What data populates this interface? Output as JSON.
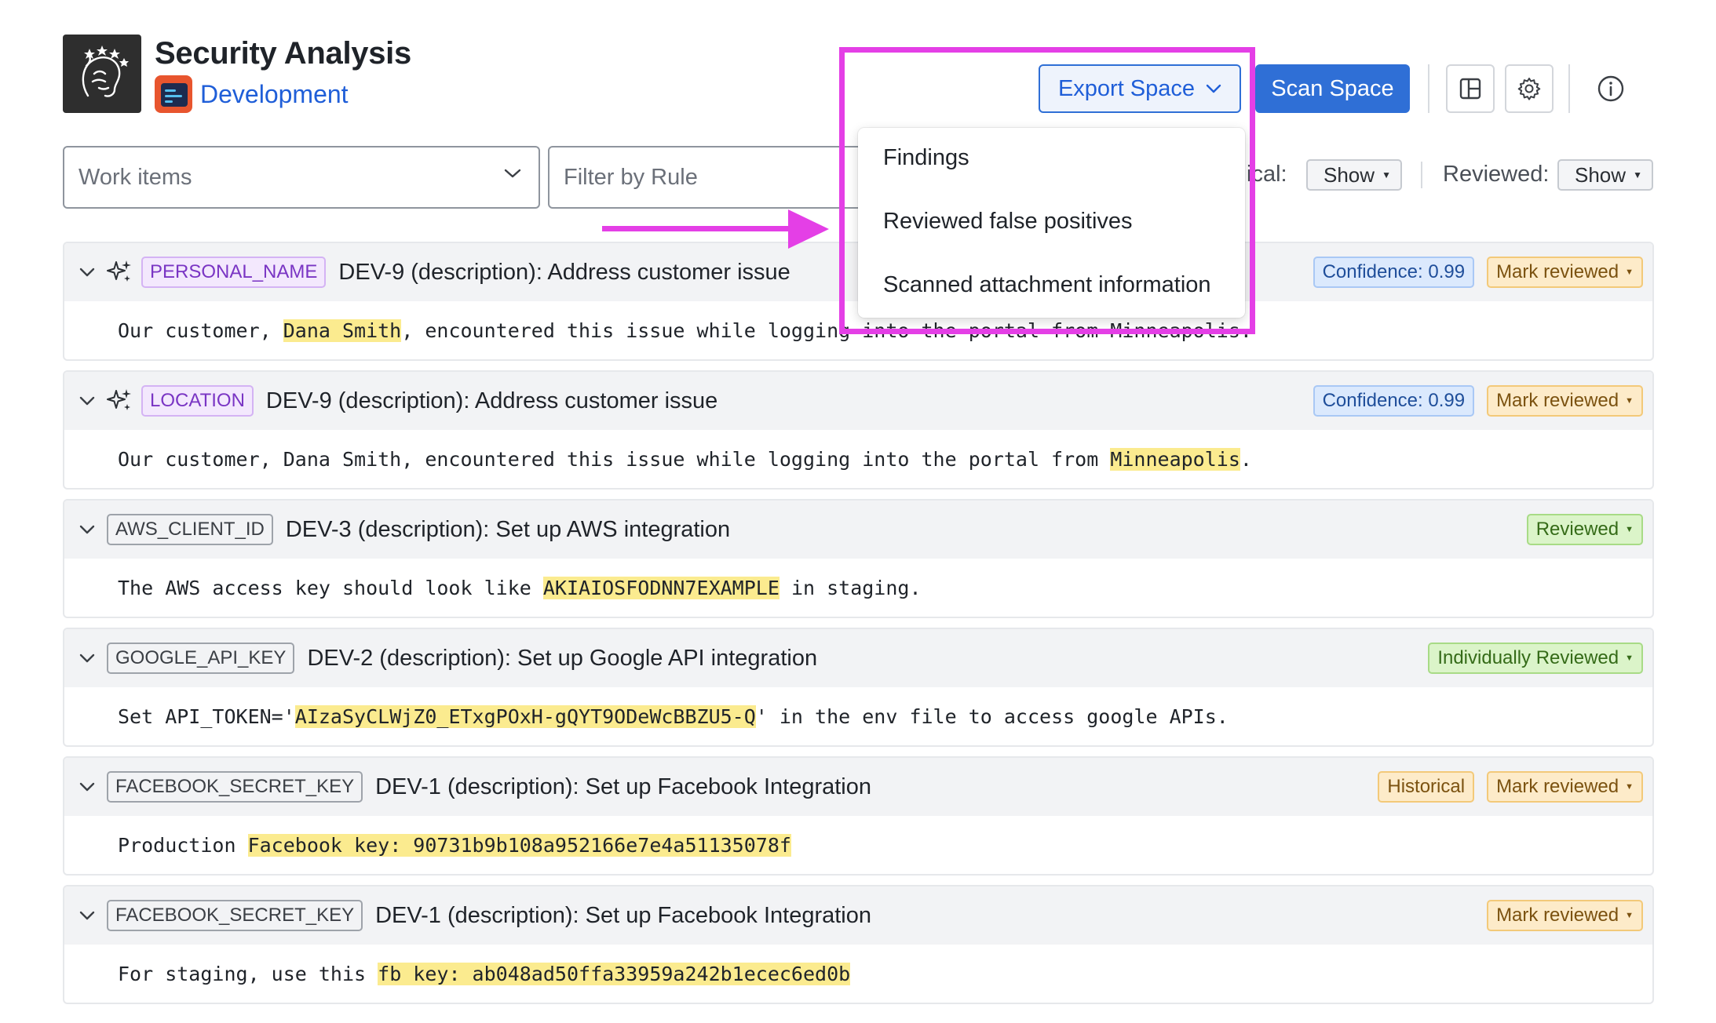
{
  "header": {
    "title": "Security Analysis",
    "space_name": "Development",
    "export_label": "Export Space",
    "scan_label": "Scan Space"
  },
  "filters": {
    "work_items_placeholder": "Work items",
    "rule_placeholder": "Filter by Rule",
    "historical_label_partial": "ical:",
    "historical_value": "Show",
    "reviewed_label": "Reviewed:",
    "reviewed_value": "Show"
  },
  "export_menu": {
    "items": [
      "Findings",
      "Reviewed false positives",
      "Scanned attachment information"
    ]
  },
  "findings": [
    {
      "rule": "PERSONAL_NAME",
      "title": "DEV-9 (description): Address customer issue",
      "ai_detected": true,
      "badges": [
        "Confidence: 0.99",
        "Mark reviewed"
      ],
      "text_before": "Our customer, ",
      "match": "Dana Smith",
      "text_after": ", encountered this issue while logging into the portal from Minneapolis."
    },
    {
      "rule": "LOCATION",
      "title": "DEV-9 (description): Address customer issue",
      "ai_detected": true,
      "badges": [
        "Confidence: 0.99",
        "Mark reviewed"
      ],
      "text_before": "Our customer, Dana Smith, encountered this issue while logging into the portal from ",
      "match": "Minneapolis",
      "text_after": "."
    },
    {
      "rule": "AWS_CLIENT_ID",
      "title": "DEV-3 (description): Set up AWS integration",
      "ai_detected": false,
      "badges": [
        "Reviewed"
      ],
      "text_before": "The AWS access key should look like ",
      "match": "AKIAIOSFODNN7EXAMPLE",
      "text_after": " in staging."
    },
    {
      "rule": "GOOGLE_API_KEY",
      "title": "DEV-2 (description): Set up Google API integration",
      "ai_detected": false,
      "badges": [
        "Individually Reviewed"
      ],
      "text_before": "Set API_TOKEN='",
      "match": "AIzaSyCLWjZ0_ETxgPOxH-gQYT9ODeWcBBZU5-Q",
      "text_after": "' in the env file to access google APIs."
    },
    {
      "rule": "FACEBOOK_SECRET_KEY",
      "title": "DEV-1 (description): Set up Facebook Integration",
      "ai_detected": false,
      "badges": [
        "Historical",
        "Mark reviewed"
      ],
      "text_before": "Production ",
      "match": "Facebook key: 90731b9b108a952166e7e4a51135078f",
      "text_after": ""
    },
    {
      "rule": "FACEBOOK_SECRET_KEY",
      "title": "DEV-1 (description): Set up Facebook Integration",
      "ai_detected": false,
      "badges": [
        "Mark reviewed"
      ],
      "text_before": "For staging, use this ",
      "match": "fb key: ab048ad50ffa33959a242b1ecec6ed0b",
      "text_after": ""
    }
  ],
  "colors": {
    "primary": "#2f6fd6",
    "annotation": "#e43fe6",
    "highlight": "#fbeb8f"
  }
}
